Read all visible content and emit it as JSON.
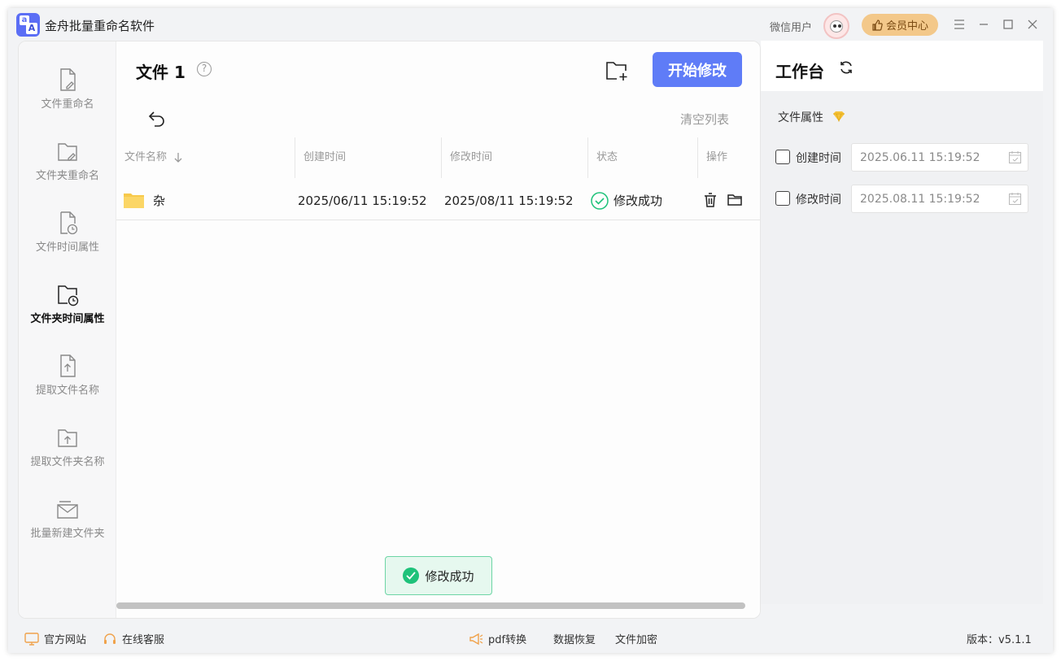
{
  "app": {
    "title": "金舟批量重命名软件",
    "logo_letters": [
      "a",
      "A"
    ]
  },
  "account": {
    "user_label": "微信用户",
    "vip_label": "会员中心"
  },
  "sidebar": {
    "items": [
      {
        "label": "文件重命名",
        "icon": "file-edit-icon"
      },
      {
        "label": "文件夹重命名",
        "icon": "folder-edit-icon"
      },
      {
        "label": "文件时间属性",
        "icon": "file-clock-icon"
      },
      {
        "label": "文件夹时间属性",
        "icon": "folder-clock-icon",
        "active": true
      },
      {
        "label": "提取文件名称",
        "icon": "file-upload-icon"
      },
      {
        "label": "提取文件夹名称",
        "icon": "folder-upload-icon"
      },
      {
        "label": "批量新建文件夹",
        "icon": "folder-mail-icon"
      }
    ]
  },
  "main": {
    "title": "文件 1",
    "help": "?",
    "start_button": "开始修改",
    "clear_list": "清空列表",
    "columns": [
      "文件名称",
      "创建时间",
      "修改时间",
      "状态",
      "操作"
    ],
    "rows": [
      {
        "name": "杂",
        "created": "2025/06/11 15:19:52",
        "modified": "2025/08/11 15:19:52",
        "status": "修改成功"
      }
    ],
    "toast": "修改成功"
  },
  "workbench": {
    "title": "工作台",
    "section_label": "文件属性",
    "fields": [
      {
        "label": "创建时间",
        "value": "2025.06.11 15:19:52",
        "checked": false
      },
      {
        "label": "修改时间",
        "value": "2025.08.11 15:19:52",
        "checked": false
      }
    ]
  },
  "footer": {
    "website": "官方网站",
    "support": "在线客服",
    "pdf": "pdf转换",
    "recovery": "数据恢复",
    "encrypt": "文件加密",
    "version": "版本：v5.1.1"
  },
  "colors": {
    "accent": "#5f7cf7",
    "success": "#1ec27a",
    "vip": "#f3c88a"
  }
}
